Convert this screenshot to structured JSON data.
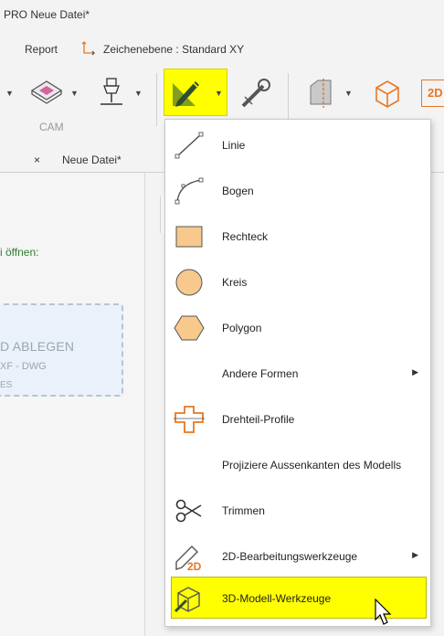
{
  "title": "PRO  Neue Datei*",
  "menu": {
    "report": "Report",
    "zeichenebene": "Zeichenebene : Standard XY"
  },
  "ribbon": {
    "cam_label": "CAM",
    "btn_2d": "2D",
    "highlight_color": "#ffff00",
    "icon_orange": "#e87722"
  },
  "tab": {
    "close": "×",
    "name": "Neue Datei*"
  },
  "left": {
    "open_text": "i öffnen:",
    "drop_title": "D ABLEGEN",
    "drop_sub1": "XF - DWG",
    "drop_sub2": "ES"
  },
  "dropdown": {
    "items": [
      {
        "label": "Linie",
        "icon": "line-icon"
      },
      {
        "label": "Bogen",
        "icon": "arc-icon"
      },
      {
        "label": "Rechteck",
        "icon": "rectangle-icon"
      },
      {
        "label": "Kreis",
        "icon": "circle-icon"
      },
      {
        "label": "Polygon",
        "icon": "polygon-icon"
      },
      {
        "label": "Andere Formen",
        "icon": "",
        "submenu": true
      },
      {
        "label": "Drehteil-Profile",
        "icon": "turned-profile-icon"
      },
      {
        "label": "Projiziere Aussenkanten des Modells",
        "icon": ""
      },
      {
        "label": "Trimmen",
        "icon": "scissors-icon"
      },
      {
        "label": "2D-Bearbeitungswerkzeuge",
        "icon": "2d-tools-icon",
        "submenu": true
      },
      {
        "label": "3D-Modell-Werkzeuge",
        "icon": "3d-model-tools-icon"
      }
    ],
    "submenu_arrow": "▶",
    "shape_fill": "#f7c98c"
  }
}
